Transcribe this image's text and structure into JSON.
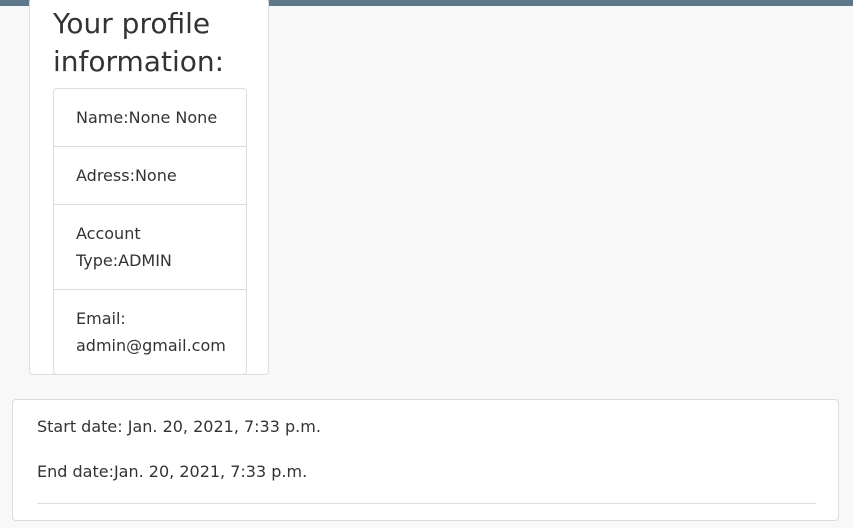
{
  "profile": {
    "title": "Your profile information:",
    "name": "Name:None None",
    "address": "Adress:None",
    "account_type": "Account Type:ADMIN",
    "email": "Email: admin@gmail.com"
  },
  "dates": {
    "start": "Start date: Jan. 20, 2021, 7:33 p.m.",
    "end": "End date:Jan. 20, 2021, 7:33 p.m."
  },
  "colors": {
    "top_bar": "#5e7889",
    "background": "#f8f8f8",
    "border": "#dcdcdc",
    "text": "#333333"
  }
}
